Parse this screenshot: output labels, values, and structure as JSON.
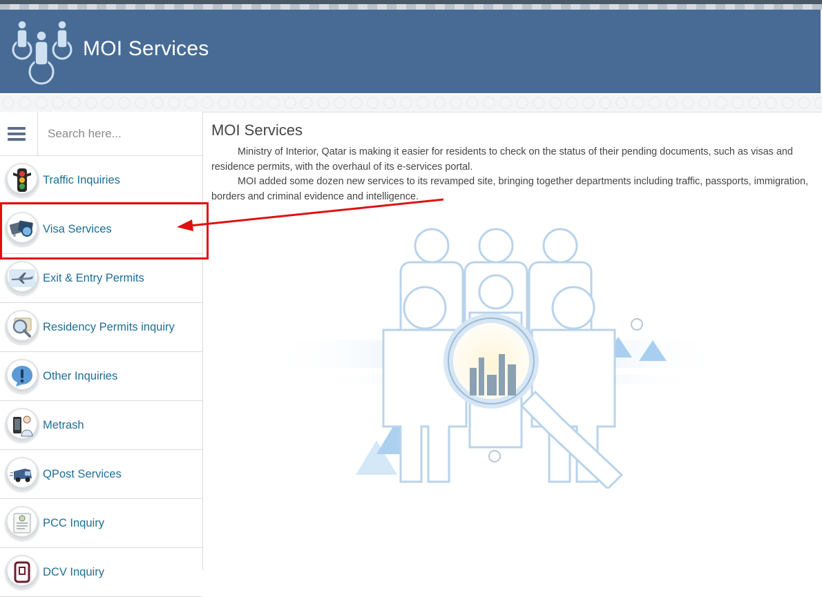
{
  "header": {
    "title": "MOI Services"
  },
  "search": {
    "placeholder": "Search here..."
  },
  "sidebar": {
    "items": [
      {
        "label": "Traffic Inquiries",
        "icon": "traffic-light-icon"
      },
      {
        "label": "Visa Services",
        "icon": "passport-icon"
      },
      {
        "label": "Exit & Entry Permits",
        "icon": "airplane-icon"
      },
      {
        "label": "Residency Permits inquiry",
        "icon": "id-card-search-icon"
      },
      {
        "label": "Other Inquiries",
        "icon": "exclamation-icon"
      },
      {
        "label": "Metrash",
        "icon": "phone-icon"
      },
      {
        "label": "QPost Services",
        "icon": "delivery-truck-icon"
      },
      {
        "label": "PCC Inquiry",
        "icon": "certificate-icon"
      },
      {
        "label": "DCV Inquiry",
        "icon": "document-icon"
      }
    ]
  },
  "content": {
    "title": "MOI Services",
    "paragraphs": [
      "Ministry of Interior, Qatar is making it easier for residents to check on the status of their pending documents, such as visas and residence permits, with the overhaul of its e-services portal.",
      "MOI added some dozen new services to its revamped site, bringing together departments including traffic, passports, immigration, borders and criminal evidence and intelligence."
    ]
  },
  "colors": {
    "header_bg": "#476b94",
    "link": "#1d6d97",
    "annotation": "#e01010"
  }
}
